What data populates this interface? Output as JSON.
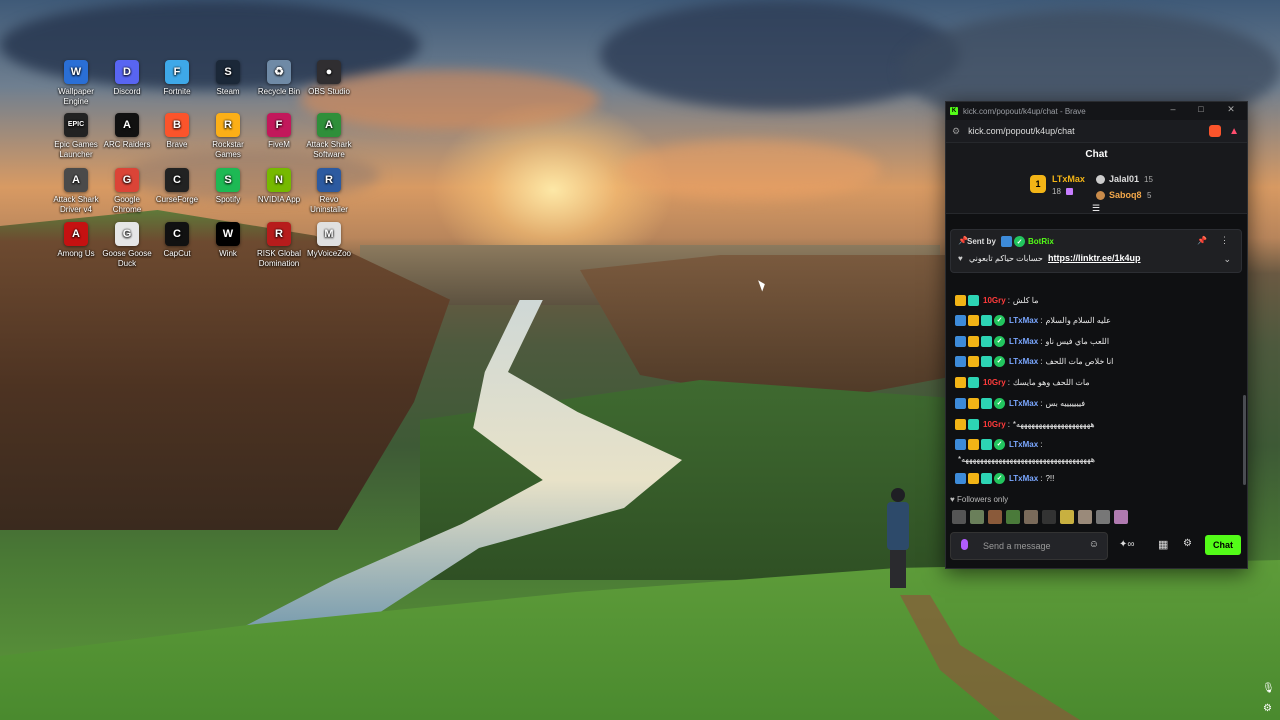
{
  "desktop": {
    "icons": [
      {
        "label": "Wallpaper Engine",
        "glyph": "W",
        "color": "#2a6fd6"
      },
      {
        "label": "Discord",
        "glyph": "D",
        "color": "#5865f2"
      },
      {
        "label": "Fortnite",
        "glyph": "F",
        "color": "#3ea8e8"
      },
      {
        "label": "Steam",
        "glyph": "S",
        "color": "#1b2838"
      },
      {
        "label": "Recycle Bin",
        "glyph": "♻",
        "color": "#6f8aa6"
      },
      {
        "label": "OBS Studio",
        "glyph": "●",
        "color": "#302e31"
      },
      {
        "label": "Epic Games Launcher",
        "glyph": "EPIC",
        "color": "#222222"
      },
      {
        "label": "ARC Raiders",
        "glyph": "A",
        "color": "#111111"
      },
      {
        "label": "Brave",
        "glyph": "B",
        "color": "#fb542b"
      },
      {
        "label": "Rockstar Games",
        "glyph": "R",
        "color": "#fcaf17"
      },
      {
        "label": "FiveM",
        "glyph": "F",
        "color": "#c2185b"
      },
      {
        "label": "Attack Shark Software",
        "glyph": "A",
        "color": "#2f8f3a"
      },
      {
        "label": "Attack Shark Driver v4",
        "glyph": "A",
        "color": "#4a4a4a"
      },
      {
        "label": "Google Chrome",
        "glyph": "G",
        "color": "#db4437"
      },
      {
        "label": "CurseForge",
        "glyph": "C",
        "color": "#222222"
      },
      {
        "label": "Spotify",
        "glyph": "S",
        "color": "#1db954"
      },
      {
        "label": "NVIDIA App",
        "glyph": "N",
        "color": "#76b900"
      },
      {
        "label": "Revo Uninstaller",
        "glyph": "R",
        "color": "#2c5aa0"
      },
      {
        "label": "Among Us",
        "glyph": "A",
        "color": "#c51111"
      },
      {
        "label": "Goose Goose Duck",
        "glyph": "G",
        "color": "#e6e6e6"
      },
      {
        "label": "CapCut",
        "glyph": "C",
        "color": "#111111"
      },
      {
        "label": "Wink",
        "glyph": "W",
        "color": "#000000"
      },
      {
        "label": "RISK Global Domination",
        "glyph": "R",
        "color": "#b71c1c"
      },
      {
        "label": "MyVoiceZoo",
        "glyph": "M",
        "color": "#e0e0e0"
      }
    ]
  },
  "browser": {
    "title": "kick.com/popout/k4up/chat - Brave",
    "url": "kick.com/popout/k4up/chat",
    "min": "–",
    "max": "□",
    "close": "✕"
  },
  "chat": {
    "header": "Chat",
    "leaderboard": {
      "first": {
        "rank": "1",
        "name": "LTxMax",
        "count": "18"
      },
      "second": {
        "name": "Jalal01",
        "count": "15"
      },
      "third": {
        "name": "Saboq8",
        "count": "5"
      }
    },
    "pinned": {
      "sent_by": "Sent by",
      "bot": "BotRix",
      "text": "حسابات حياكم تابعوني",
      "link": "https://linktr.ee/1k4up"
    },
    "messages": [
      {
        "user": "10Gry",
        "text": "ما كلش"
      },
      {
        "user": "LTxMax",
        "text": "عليه السلام والسلام"
      },
      {
        "user": "LTxMax",
        "text": "اللعب ماي فيس ناو"
      },
      {
        "user": "LTxMax",
        "text": "انا خلاص مات اللحف"
      },
      {
        "user": "10Gry",
        "text": "مات اللحف وهو مايسك"
      },
      {
        "user": "LTxMax",
        "text": "فيييييييه بس"
      },
      {
        "user": "10Gry",
        "text": "*ههههههههههههههههههههه"
      },
      {
        "user": "LTxMax",
        "text": ""
      },
      {
        "user": "",
        "text": "*هههههههههههههههههههههههههههههههههههه"
      },
      {
        "user": "LTxMax",
        "text": "?!!"
      }
    ],
    "followers_only": "Followers only",
    "input_placeholder": "Send a message",
    "send_label": "Chat"
  }
}
